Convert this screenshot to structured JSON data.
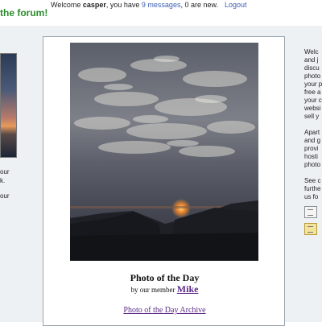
{
  "header": {
    "forum_title_fragment": "the forum!",
    "welcome_prefix": "Welcome ",
    "username": "casper",
    "messages_prefix": ", you have ",
    "messages_link": "9 messages",
    "messages_suffix": ", 0 are new.",
    "logout_label": "Logout"
  },
  "left_column": {
    "text_1_lines": [
      "our",
      "k."
    ],
    "text_2_lines": [
      "our"
    ]
  },
  "photo_of_the_day": {
    "title": "Photo of the Day",
    "byline_prefix": "by our member",
    "member_name": "Mike",
    "archive_link": "Photo of the Day Archive"
  },
  "right_column": {
    "para_1_lines": [
      "Welc",
      "and j",
      "discu",
      "photo",
      "your p",
      "free a",
      "your c",
      "websi",
      "sell y"
    ],
    "para_2_lines": [
      "Apart",
      "and g",
      "provi",
      "hosti",
      "photo"
    ],
    "para_3_lines": [
      "See c",
      "furthe",
      "us fo"
    ],
    "icons": [
      "document-icon",
      "folder-icon"
    ]
  }
}
